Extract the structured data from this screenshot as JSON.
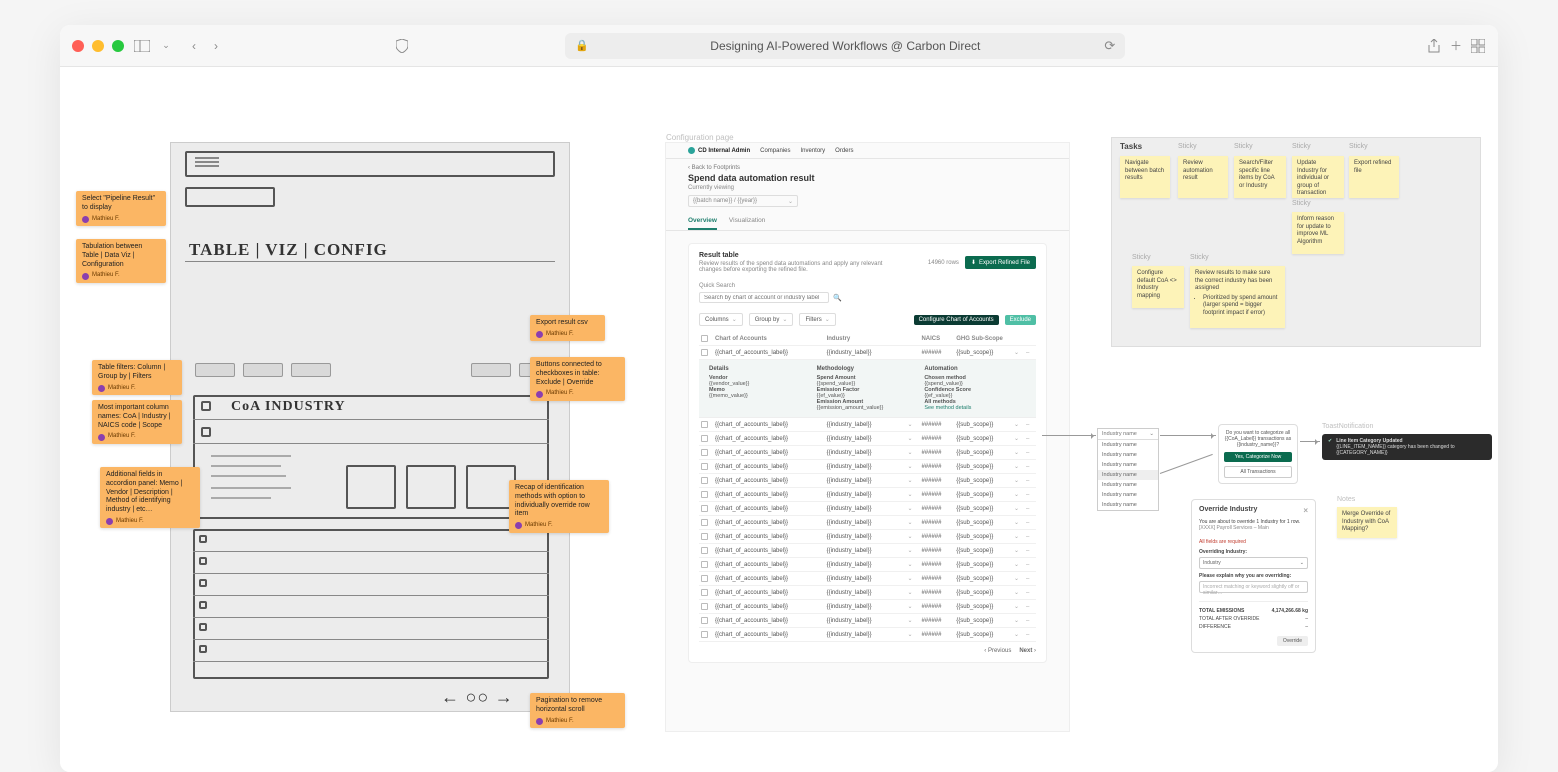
{
  "browser": {
    "page_title": "Designing AI-Powered Workflows @ Carbon Direct"
  },
  "orange_notes": {
    "author": "Mathieu F.",
    "n1": "Select \"Pipeline Result\" to display",
    "n2": "Tabulation between Table | Data Viz | Configuration",
    "n3": "Table filters: Column | Group by | Filters",
    "n4": "Most important column names: CoA | Industry | NAICS code | Scope",
    "n5": "Additional fields in accordion panel: Memo | Vendor | Description | Method of identifying industry | etc…",
    "n6": "Export result csv",
    "n7": "Buttons connected to checkboxes in table: Exclude | Override",
    "n8": "Recap of identification methods with option to individually override row item",
    "n9": "Pagination to remove horizontal scroll"
  },
  "sketch": {
    "tabs": "TABLE | VIZ | CONFIG",
    "cols": "CoA   INDUSTRY"
  },
  "mock": {
    "frame_label": "Configuration page",
    "brand": "CD Internal Admin",
    "nav": [
      "Companies",
      "Inventory",
      "Orders"
    ],
    "back": "‹  Back to Footprints",
    "title": "Spend data automation result",
    "sub": "Currently viewing",
    "select_val": "{{batch name}} / {{year}}",
    "tabs": {
      "overview": "Overview",
      "viz": "Visualization"
    },
    "card": {
      "title": "Result table",
      "desc": "Review results of the spend data automations and apply any relevant changes before exporting the refined file.",
      "rows_meta": "14960 rows",
      "export_btn": "Export Refined File",
      "qs_label": "Quick Search",
      "qs_placeholder": "Search by chart of account or industry label",
      "columns_btn": "Columns",
      "groupby_btn": "Group by",
      "filters_btn": "Filters",
      "config_btn": "Configure Chart of Accounts",
      "exclude_btn": "Exclude",
      "head": {
        "coa": "Chart of Accounts",
        "ind": "Industry",
        "naics": "NAICS",
        "scope": "GHG Sub-Scope"
      },
      "cell_coa": "{{chart_of_accounts_label}}",
      "cell_ind": "{{industry_label}}",
      "cell_naics": "######",
      "cell_scope": "{{sub_scope}}",
      "exp": {
        "details": "Details",
        "vendor_l": "Vendor",
        "vendor_v": "{{vendor_value}}",
        "memo_l": "Memo",
        "memo_v": "{{memo_value}}",
        "method": "Methodology",
        "sa_l": "Spend Amount",
        "sa_v": "{{spend_value}}",
        "ef_l": "Emission Factor",
        "ef_v": "{{ef_value}}",
        "ea_l": "Emission Amount",
        "ea_v": "{{emission_amount_value}}",
        "auto": "Automation",
        "cm_l": "Chosen method",
        "cm_v": "{{spend_value}}",
        "cs_l": "Confidence Score",
        "cs_v": "{{ef_value}}",
        "am_l": "All methods",
        "see": "See method details"
      },
      "prev": "Previous",
      "next": "Next"
    }
  },
  "board": {
    "tasks": "Tasks",
    "sticky_lbl": "Sticky",
    "s1": "Navigate between batch results",
    "s2": "Review automation result",
    "s3": "Search/Filter specific line items by CoA or Industry",
    "s4": "Update Industry for individual or group of transaction",
    "s5": "Export refined file",
    "s6": "Inform reason for update to improve ML Algorithm",
    "s7": "Configure default CoA <> Industry mapping",
    "s8_t": "Review results to make sure the correct industry has been assigned",
    "s8_b": "Prioritized by spend amount (larger spend = bigger footprint impact if error)"
  },
  "dropdown": {
    "sel": "Industry name",
    "item": "Industry name"
  },
  "mini": {
    "q": "Do you want to categorize all {{CoA_Label}} transactions as {{industry_name}}?",
    "yes": "Yes, Categorize Now",
    "all": "All Transactions"
  },
  "toast": {
    "label": "ToastNotification",
    "title": "Line Item Category Updated",
    "body": "{{LINE_ITEM_NAME}} category has been changed to {{CATEGORY_NAME}}"
  },
  "notes": {
    "label": "Notes",
    "n1": "Merge Override of Industry with CoA Mapping?"
  },
  "override": {
    "title": "Override Industry",
    "sub": "You are about to override 1 Industry for 1 row.",
    "sub2": "[XXXX] Payroll Services – Main",
    "req": "All fields are required",
    "ind_l": "Overriding Industry:",
    "ind_v": "Industry",
    "why_l": "Please explain why you are overriding:",
    "why_ph": "Incorrect matching or keyword slightly off or similar…",
    "t1_l": "TOTAL EMISSIONS",
    "t1_v": "4,174,266.68 kg",
    "t2_l": "TOTAL AFTER OVERRIDE",
    "t2_v": "–",
    "t3_l": "DIFFERENCE",
    "t3_v": "–",
    "btn": "Override"
  }
}
